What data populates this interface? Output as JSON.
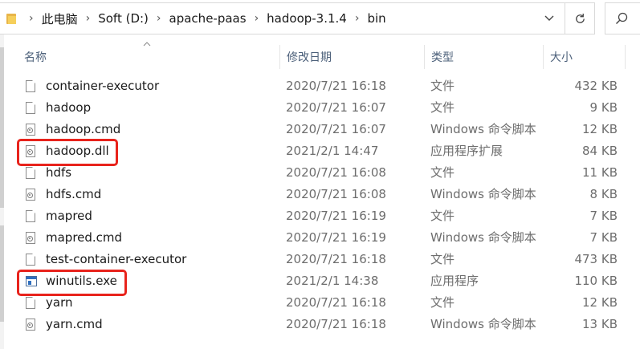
{
  "breadcrumb": [
    "此电脑",
    "Soft (D:)",
    "apache-paas",
    "hadoop-3.1.4",
    "bin"
  ],
  "columns": {
    "name": "名称",
    "date": "修改日期",
    "type": "类型",
    "size": "大小"
  },
  "files": [
    {
      "name": "container-executor",
      "date": "2020/7/21 16:18",
      "type": "文件",
      "size": "432 KB",
      "icon": "file-icon"
    },
    {
      "name": "hadoop",
      "date": "2020/7/21 16:07",
      "type": "文件",
      "size": "9 KB",
      "icon": "file-icon"
    },
    {
      "name": "hadoop.cmd",
      "date": "2020/7/21 16:07",
      "type": "Windows 命令脚本",
      "size": "12 KB",
      "icon": "cmd-script-icon"
    },
    {
      "name": "hadoop.dll",
      "date": "2021/2/1 14:47",
      "type": "应用程序扩展",
      "size": "84 KB",
      "icon": "dll-icon"
    },
    {
      "name": "hdfs",
      "date": "2020/7/21 16:08",
      "type": "文件",
      "size": "11 KB",
      "icon": "file-icon"
    },
    {
      "name": "hdfs.cmd",
      "date": "2020/7/21 16:08",
      "type": "Windows 命令脚本",
      "size": "8 KB",
      "icon": "cmd-script-icon"
    },
    {
      "name": "mapred",
      "date": "2020/7/21 16:19",
      "type": "文件",
      "size": "7 KB",
      "icon": "file-icon"
    },
    {
      "name": "mapred.cmd",
      "date": "2020/7/21 16:19",
      "type": "Windows 命令脚本",
      "size": "7 KB",
      "icon": "cmd-script-icon"
    },
    {
      "name": "test-container-executor",
      "date": "2020/7/21 16:18",
      "type": "文件",
      "size": "473 KB",
      "icon": "file-icon"
    },
    {
      "name": "winutils.exe",
      "date": "2021/2/1 14:38",
      "type": "应用程序",
      "size": "110 KB",
      "icon": "exe-icon"
    },
    {
      "name": "yarn",
      "date": "2020/7/21 16:18",
      "type": "文件",
      "size": "12 KB",
      "icon": "file-icon"
    },
    {
      "name": "yarn.cmd",
      "date": "2020/7/21 16:18",
      "type": "Windows 命令脚本",
      "size": "13 KB",
      "icon": "cmd-script-icon"
    }
  ],
  "icons": {
    "folder": "folder-icon",
    "dropdown": "chevron-down-icon",
    "refresh": "refresh-icon",
    "search": "search-icon",
    "sort": "sort-up-icon"
  },
  "colors": {
    "highlight": "#e8231c",
    "header_text": "#4c607a",
    "secondary_text": "#6d6d6d"
  }
}
